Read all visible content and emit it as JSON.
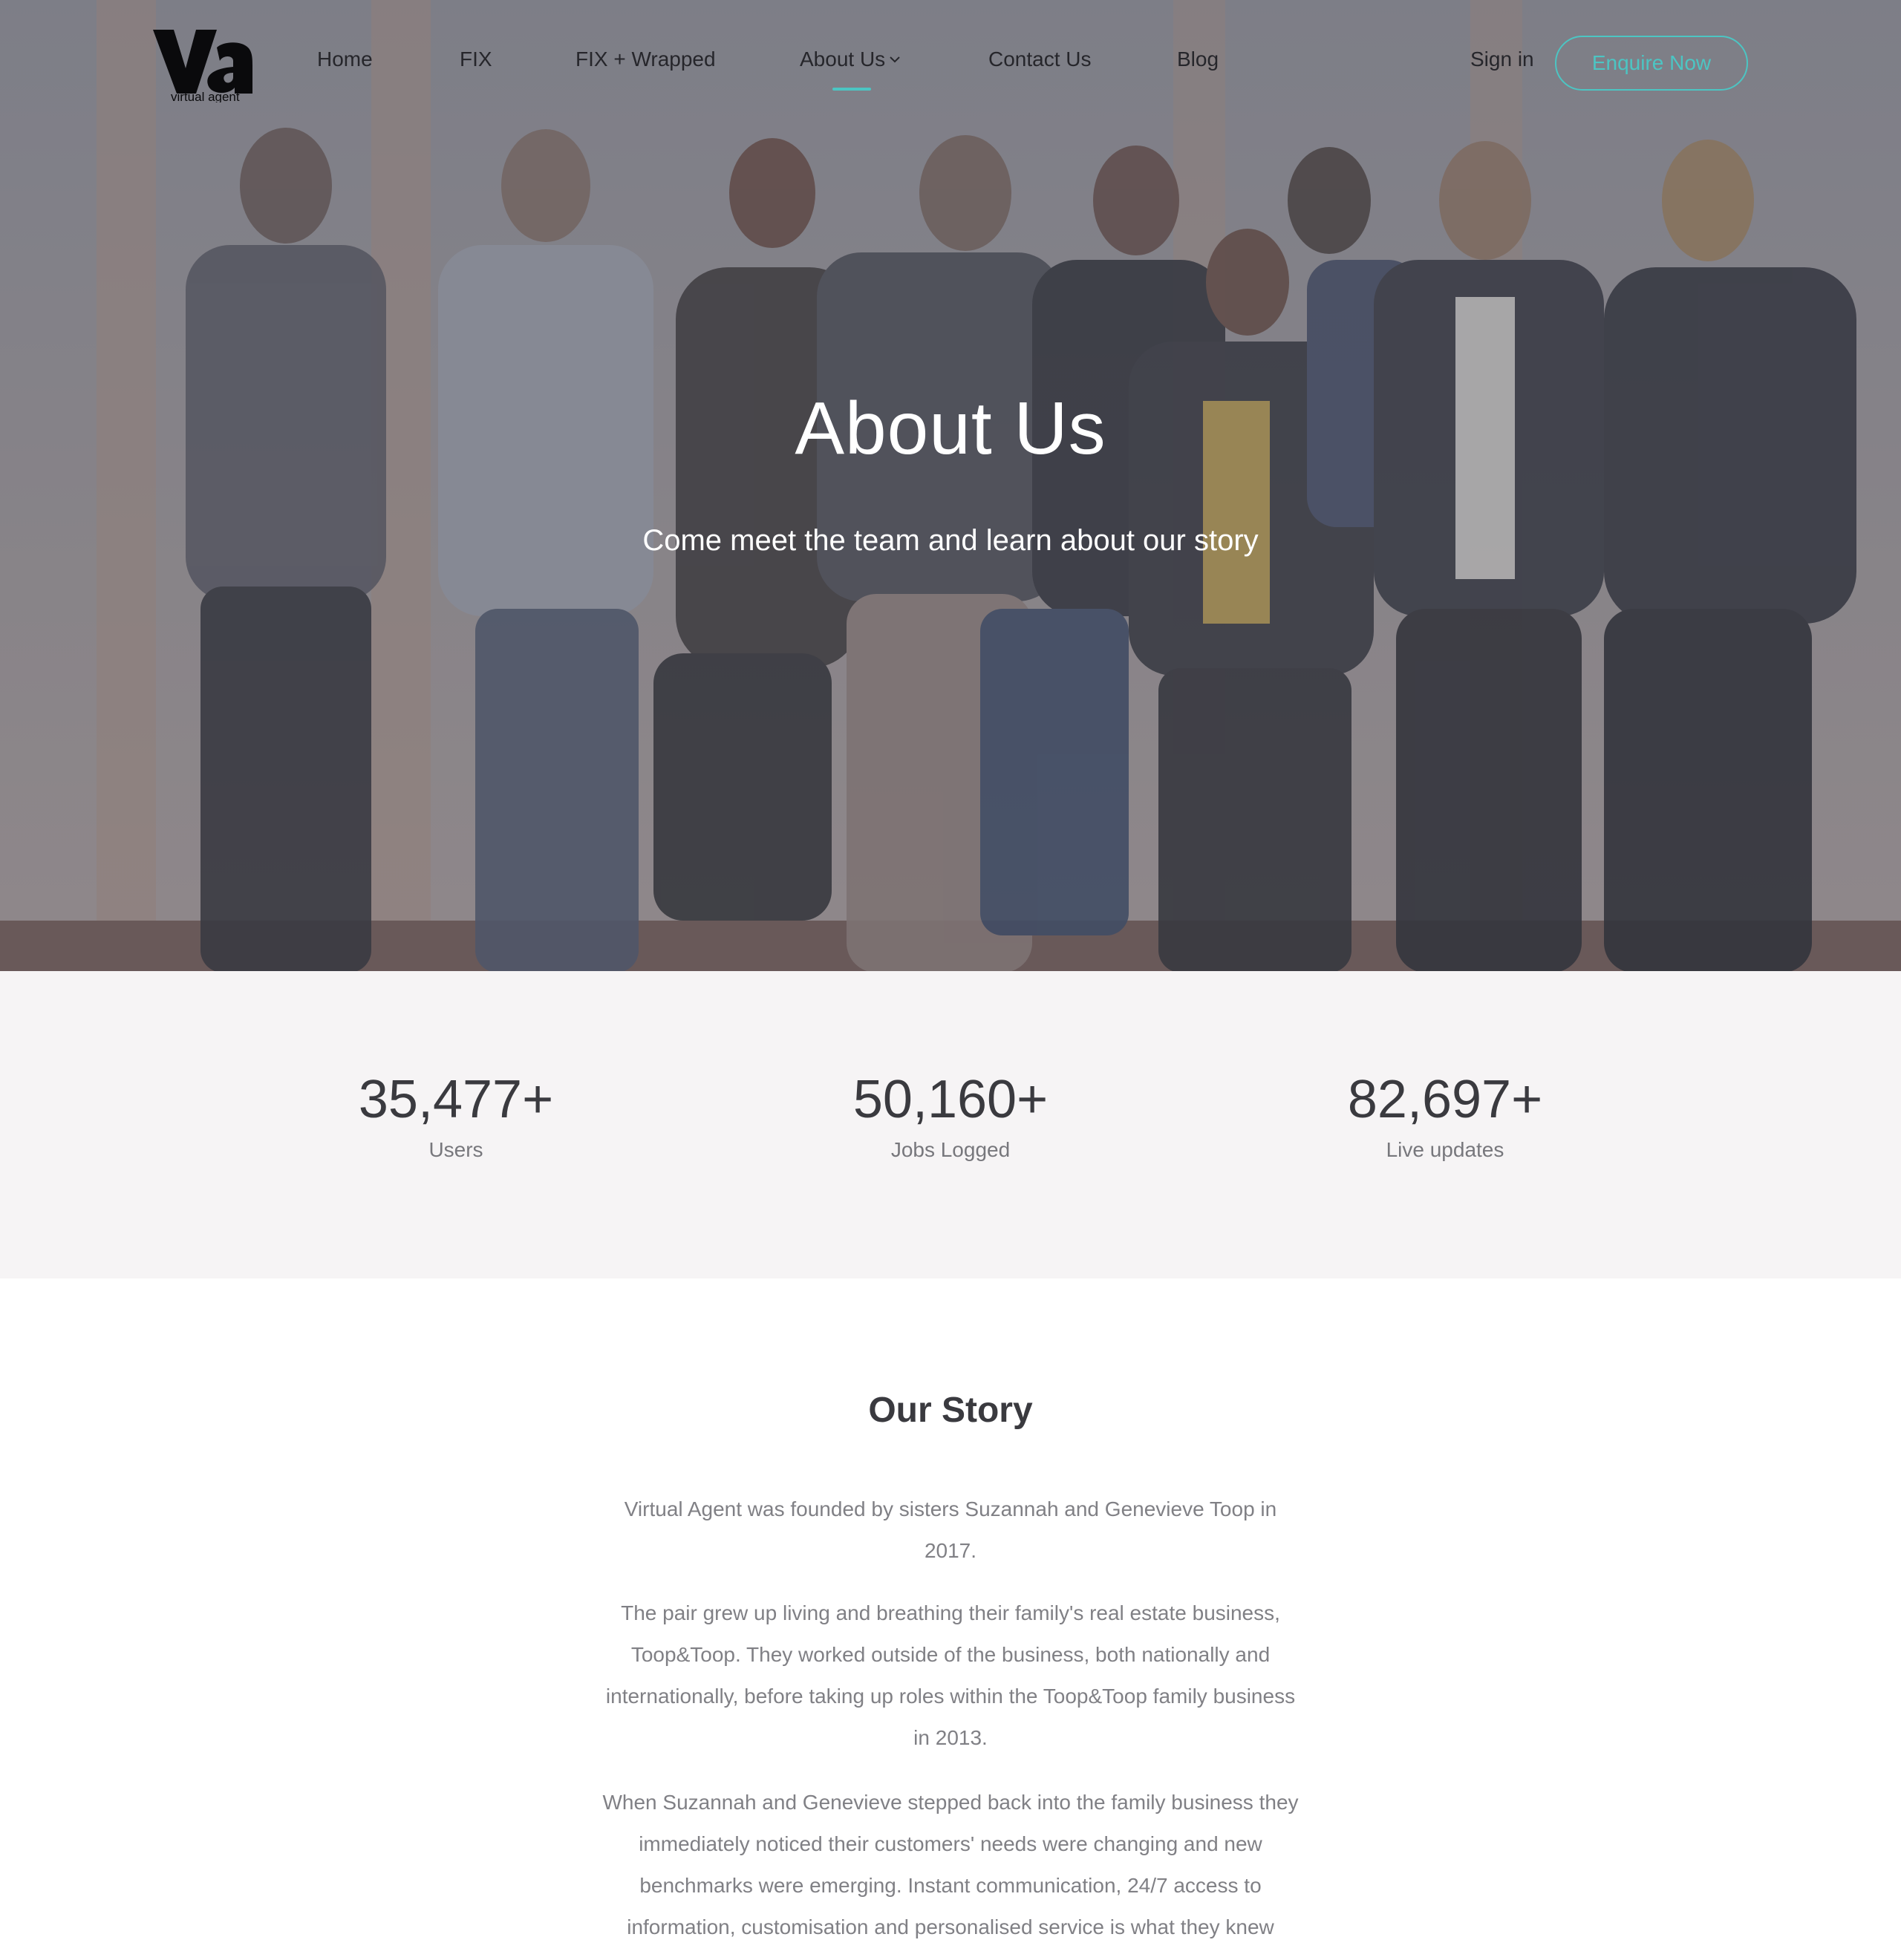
{
  "nav": {
    "logo_text": "va",
    "logo_subtext": "virtual agent",
    "links": [
      "Home",
      "FIX",
      "FIX + Wrapped",
      "About Us",
      "Contact Us",
      "Blog"
    ],
    "sign_in": "Sign in",
    "enquire": "Enquire Now",
    "active_index": 3
  },
  "hero": {
    "title": "About Us",
    "subtitle": "Come meet the team and learn about our story"
  },
  "stats": [
    {
      "value": "35,477+",
      "label": "Users"
    },
    {
      "value": "50,160+",
      "label": "Jobs Logged"
    },
    {
      "value": "82,697+",
      "label": "Live updates"
    }
  ],
  "story": {
    "title": "Our Story",
    "paragraphs": [
      "Virtual Agent was founded by sisters Suzannah and Genevieve Toop in 2017.",
      "The pair grew up living and breathing their family's real estate business, Toop&Toop. They worked outside of the business, both nationally and internationally, before taking up roles within the Toop&Toop family business in 2013.",
      "When Suzannah and Genevieve stepped back into the family business they immediately noticed their customers' needs were changing and new benchmarks were emerging. Instant communication, 24/7 access to information, customisation and personalised service is what they knew"
    ]
  },
  "colors": {
    "accent": "#4cc5c3",
    "stats_bg": "#f6f4f5",
    "heading": "#3a3a3f",
    "body_text": "#808085"
  },
  "icons": {
    "about_dropdown": "chevron-down-icon"
  }
}
